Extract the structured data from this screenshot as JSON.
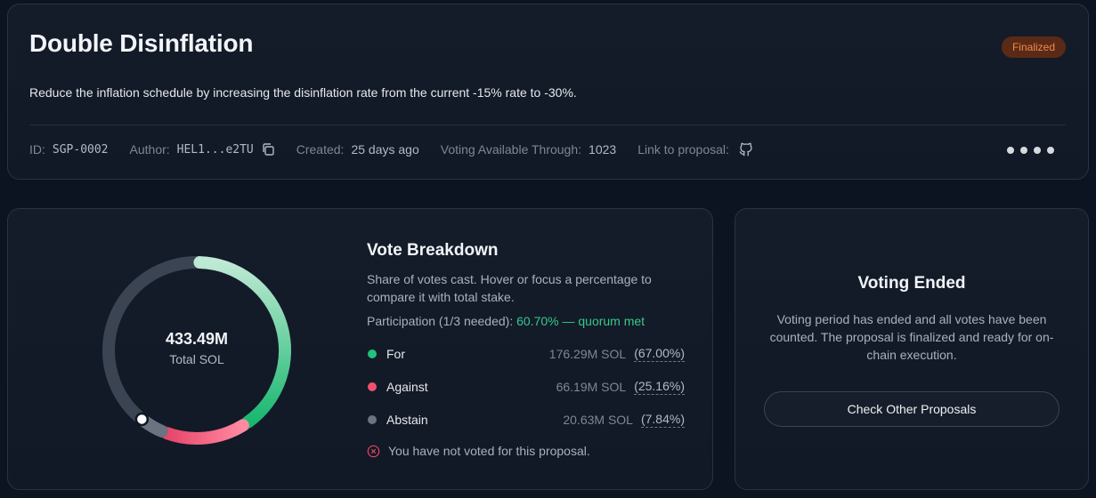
{
  "proposal": {
    "title": "Double Disinflation",
    "status": "Finalized",
    "description": "Reduce the inflation schedule by increasing the disinflation rate from the current -15% rate to -30%.",
    "meta": {
      "id_label": "ID:",
      "id_value": "SGP-0002",
      "author_label": "Author:",
      "author_value": "HEL1...e2TU",
      "created_label": "Created:",
      "created_value": "25 days ago",
      "voting_label": "Voting Available Through:",
      "voting_value": "1023",
      "link_label": "Link to proposal:"
    },
    "icons": {
      "copy": "copy-icon",
      "link": "github-icon",
      "more": "more-dots-icon"
    }
  },
  "breakdown": {
    "title": "Vote Breakdown",
    "description": "Share of votes cast. Hover or focus a percentage to compare it with total stake.",
    "participation_label": "Participation (1/3 needed):",
    "participation_value": "60.70% — quorum met",
    "total_value": "433.49M",
    "total_label": "Total SOL",
    "rows": [
      {
        "label": "For",
        "sol": "176.29M SOL",
        "pct": "(67.00%)",
        "color": "#22c07a"
      },
      {
        "label": "Against",
        "sol": "66.19M SOL",
        "pct": "(25.16%)",
        "color": "#f0516e"
      },
      {
        "label": "Abstain",
        "sol": "20.63M SOL",
        "pct": "(7.84%)",
        "color": "#6b7280"
      }
    ],
    "not_voted": "You have not voted for this proposal.",
    "track_color": "#3b4452"
  },
  "ended": {
    "title": "Voting Ended",
    "description": "Voting period has ended and all votes have been counted. The proposal is finalized and ready for on-chain execution.",
    "button_label": "Check Other Proposals"
  },
  "chart_data": {
    "type": "pie",
    "variant": "donut",
    "categories": [
      "For",
      "Against",
      "Abstain"
    ],
    "values": [
      176.29,
      66.19,
      20.63
    ],
    "units": "M SOL",
    "total_stake": 433.49,
    "participation_pct": 60.7,
    "colors": [
      "#22c07a",
      "#f0516e",
      "#6b7280"
    ]
  }
}
